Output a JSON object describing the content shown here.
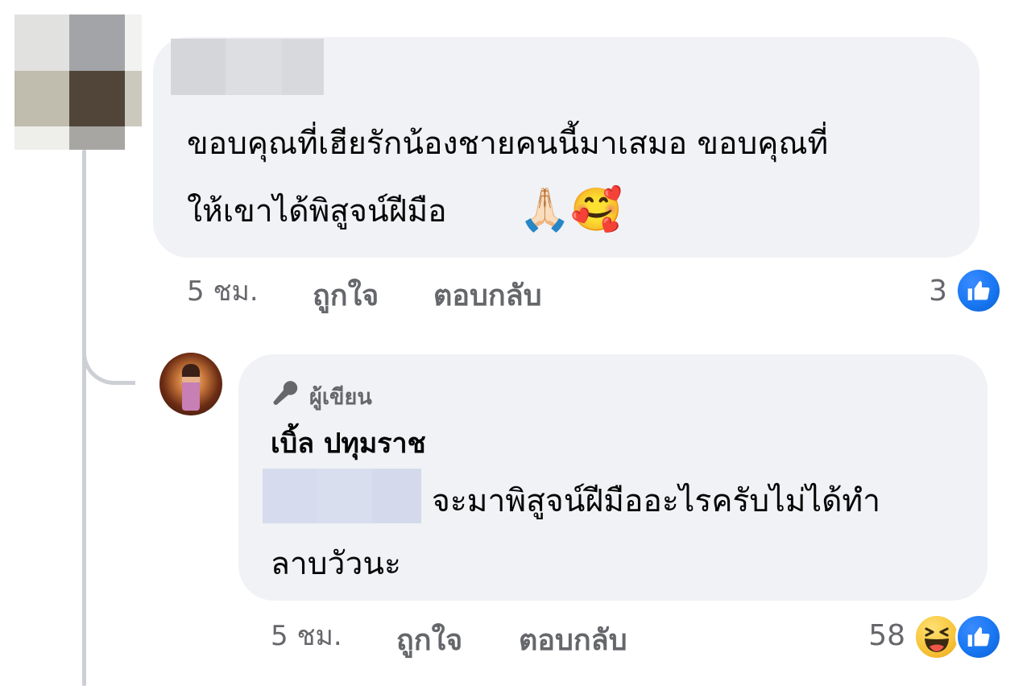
{
  "comment": {
    "text_line1": "ขอบคุณที่เฮียรักน้องชายคนนี้มาเสมอ ขอบคุณที่",
    "text_line2": "ให้เขาได้พิสูจน์ฝีมือ",
    "emojis": [
      "🙏🏻",
      "🥰"
    ],
    "timestamp": "5 ชม.",
    "like_label": "ถูกใจ",
    "reply_label": "ตอบกลับ",
    "reaction_count": "3",
    "reactions": [
      "like"
    ]
  },
  "reply": {
    "badge": "ผู้เขียน",
    "author": "เบิ้ล ปทุมราช",
    "text_line1": "จะมาพิสูจน์ฝีมืออะไรครับไม่ได้ทำ",
    "text_line2": "ลาบวัวนะ",
    "timestamp": "5 ชม.",
    "like_label": "ถูกใจ",
    "reply_label": "ตอบกลับ",
    "reaction_count": "58",
    "reactions": [
      "haha",
      "like"
    ]
  },
  "colors": {
    "bubble": "#f0f2f5",
    "secondary_text": "#65676b",
    "like_blue": "#1877f2",
    "thread_line": "#ccd0d5"
  },
  "icons": {
    "like": "thumbs-up-icon",
    "haha": "laughing-face-icon",
    "author_badge": "microphone-icon"
  }
}
